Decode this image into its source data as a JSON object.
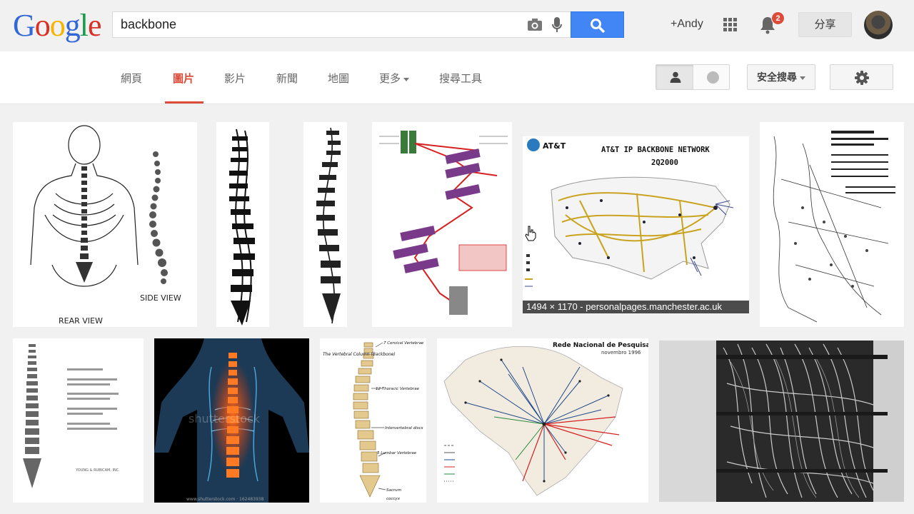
{
  "logo": {
    "letters": [
      "G",
      "o",
      "o",
      "g",
      "l",
      "e"
    ]
  },
  "search": {
    "query": "backbone",
    "camera_icon": "camera-icon",
    "mic_icon": "mic-icon",
    "button_icon": "magnifier-icon"
  },
  "header": {
    "user": "+Andy",
    "notifications": "2",
    "share": "分享",
    "apps_icon": "apps-grid-icon"
  },
  "nav": {
    "tabs": [
      {
        "label": "網頁"
      },
      {
        "label": "圖片"
      },
      {
        "label": "影片"
      },
      {
        "label": "新聞"
      },
      {
        "label": "地圖"
      },
      {
        "label": "更多"
      },
      {
        "label": "搜尋工具"
      }
    ],
    "active_tab": "圖片",
    "safe_search": "安全搜尋",
    "accent": "#dd4b39"
  },
  "results": {
    "hover_caption": "1494 × 1170 - personalpages.manchester.ac.uk",
    "images": [
      {
        "labels": [
          "REAR VIEW",
          "SIDE VIEW"
        ]
      },
      {
        "labels": []
      },
      {
        "labels": []
      },
      {
        "labels": []
      },
      {
        "labels": [
          "AT&T",
          "AT&T IP BACKBONE NETWORK",
          "2Q2000"
        ]
      },
      {
        "labels": []
      },
      {
        "labels": [
          "YOUNG & RUBICAM, INC."
        ]
      },
      {
        "labels": [
          "shutterstock",
          "www.shutterstock.com · 162483938"
        ]
      },
      {
        "labels": [
          "The Vertebral Column (Backbone)",
          "7 Cervical Vertebrae",
          "12 Thoracic Vertebrae",
          "Intervertebral discs",
          "5 Lumbar Vertebrae",
          "Sacrum",
          "coccyx"
        ]
      },
      {
        "labels": [
          "Rede Nacional de Pesquisa",
          "novembro 1996"
        ]
      },
      {
        "labels": []
      }
    ]
  }
}
